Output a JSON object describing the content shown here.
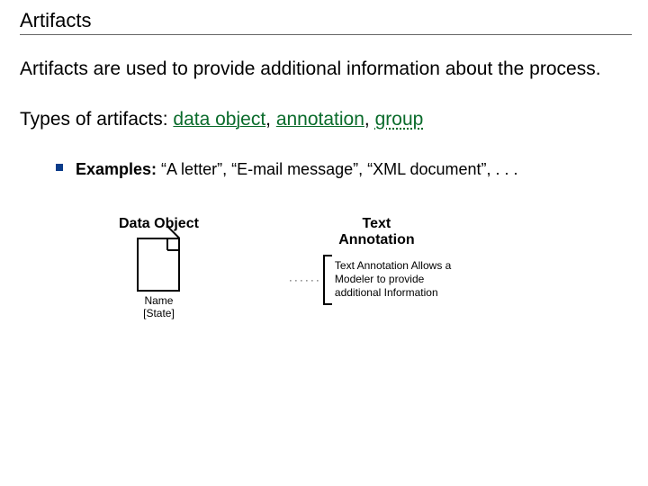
{
  "title": "Artifacts",
  "intro": "Artifacts are used to provide additional information about the process.",
  "types_line": {
    "prefix": "Types of artifacts: ",
    "item1": "data object",
    "sep": ", ",
    "item2": "annotation",
    "item3": "group"
  },
  "examples": {
    "label": "Examples:",
    "text": " “A letter”, “E-mail message”, “XML document”, . . ."
  },
  "diagram": {
    "data_object": {
      "title": "Data Object",
      "caption_line1": "Name",
      "caption_line2": "[State]"
    },
    "text_annotation": {
      "title_line1": "Text",
      "title_line2": "Annotation",
      "body": "Text Annotation Allows a Modeler to provide additional Information"
    }
  }
}
